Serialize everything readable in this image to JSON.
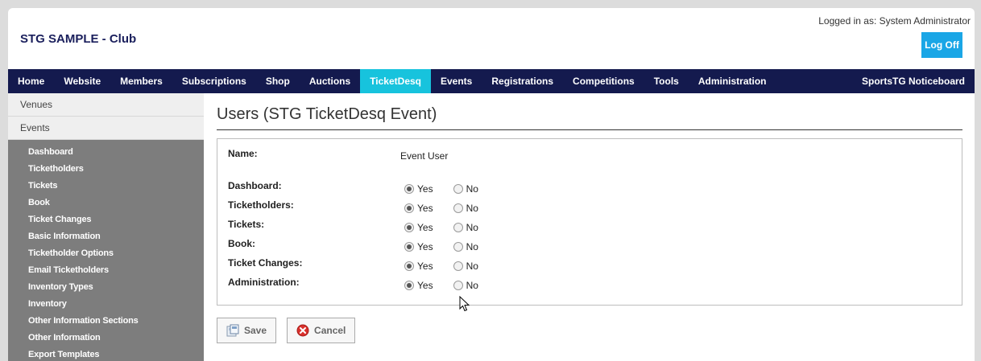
{
  "header": {
    "club_title": "STG SAMPLE - Club",
    "logged_in": "Logged in as: System Administrator",
    "logoff_label": "Log Off"
  },
  "nav": {
    "items": [
      "Home",
      "Website",
      "Members",
      "Subscriptions",
      "Shop",
      "Auctions",
      "TicketDesq",
      "Events",
      "Registrations",
      "Competitions",
      "Tools",
      "Administration"
    ],
    "active": "TicketDesq",
    "right": "SportsTG Noticeboard"
  },
  "sidebar": {
    "top_items": [
      "Venues",
      "Events"
    ],
    "sub_items": [
      "Dashboard",
      "Ticketholders",
      "Tickets",
      "Book",
      "Ticket Changes",
      "Basic Information",
      "Ticketholder Options",
      "Email Ticketholders",
      "Inventory Types",
      "Inventory",
      "Other Information Sections",
      "Other Information",
      "Export Templates"
    ]
  },
  "main": {
    "title": "Users (STG TicketDesq Event)",
    "name_label": "Name:",
    "name_value": "Event User",
    "yes_label": "Yes",
    "no_label": "No",
    "permissions": [
      {
        "label": "Dashboard:",
        "value": "Yes"
      },
      {
        "label": "Ticketholders:",
        "value": "Yes"
      },
      {
        "label": "Tickets:",
        "value": "Yes"
      },
      {
        "label": "Book:",
        "value": "Yes"
      },
      {
        "label": "Ticket Changes:",
        "value": "Yes"
      },
      {
        "label": "Administration:",
        "value": "Yes"
      }
    ],
    "save_label": "Save",
    "cancel_label": "Cancel"
  },
  "colors": {
    "nav_bg": "#141a4e",
    "nav_active": "#17c3dd",
    "logoff_bg": "#1aa6e6",
    "sidebar_bg": "#7d7d7d"
  }
}
